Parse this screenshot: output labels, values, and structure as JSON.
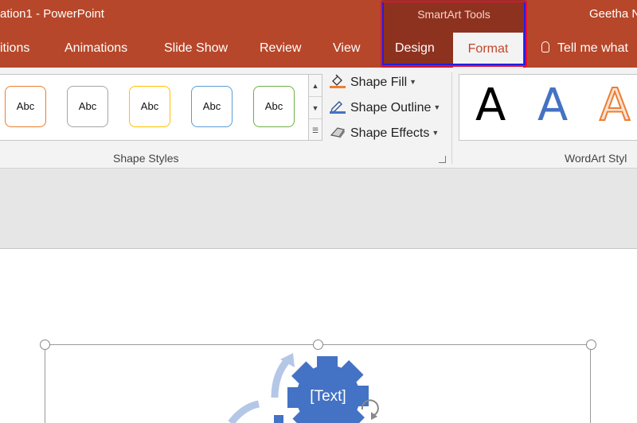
{
  "window": {
    "title": "ation1  -  PowerPoint",
    "user": "Geetha N"
  },
  "contextual": {
    "group_title": "SmartArt Tools",
    "tabs": [
      "Design",
      "Format"
    ],
    "active_tab": "Format"
  },
  "tabs": [
    {
      "label": "itions"
    },
    {
      "label": "Animations"
    },
    {
      "label": "Slide Show"
    },
    {
      "label": "Review"
    },
    {
      "label": "View"
    }
  ],
  "tell_me": "Tell me what",
  "ribbon": {
    "shape_styles": {
      "label": "Shape Styles",
      "gallery": [
        {
          "text": "Abc",
          "color": "#ed7d31"
        },
        {
          "text": "Abc",
          "color": "#a5a5a5"
        },
        {
          "text": "Abc",
          "color": "#ffc000"
        },
        {
          "text": "Abc",
          "color": "#5b9bd5"
        },
        {
          "text": "Abc",
          "color": "#70ad47"
        }
      ],
      "fill": "Shape Fill",
      "outline": "Shape Outline",
      "effects": "Shape Effects"
    },
    "wordart_styles": {
      "label": "WordArt Styl",
      "letters": [
        "A",
        "A",
        "A"
      ]
    }
  },
  "smartart": {
    "node_text": "[Text]",
    "accent": "#4472c4"
  },
  "colors": {
    "title_bar": "#b7472a",
    "contextual_group": "#8e3220"
  }
}
